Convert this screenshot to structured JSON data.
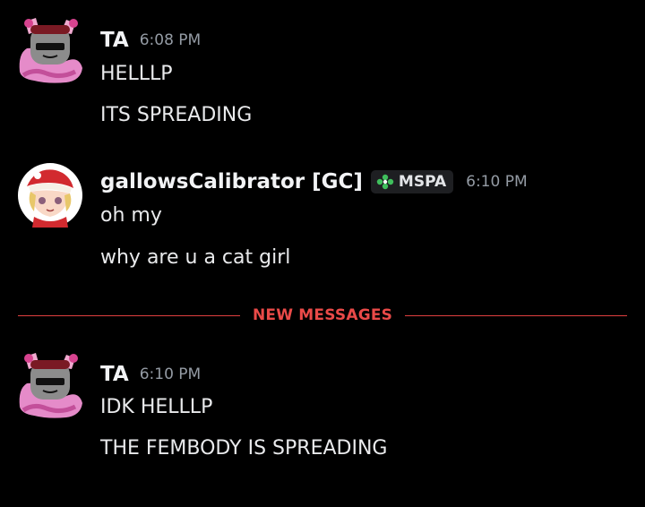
{
  "messages": [
    {
      "author": "TA",
      "timestamp": "6:08 PM",
      "lines": [
        "HELLLP",
        "ITS SPREADING"
      ]
    },
    {
      "author": "gallowsCalibrator [GC]",
      "tag": "MSPA",
      "timestamp": "6:10 PM",
      "lines": [
        "oh my",
        "why are u a cat girl"
      ]
    },
    {
      "author": "TA",
      "timestamp": "6:10 PM",
      "lines": [
        "IDK HELLLP",
        "THE FEMBODY IS SPREADING"
      ]
    }
  ],
  "divider": {
    "label": "NEW MESSAGES",
    "color": "#e0403f"
  },
  "colors": {
    "background": "#000000",
    "username": "#f2f3f5",
    "timestamp": "#949ba4",
    "tag_background": "#1e1f22"
  }
}
